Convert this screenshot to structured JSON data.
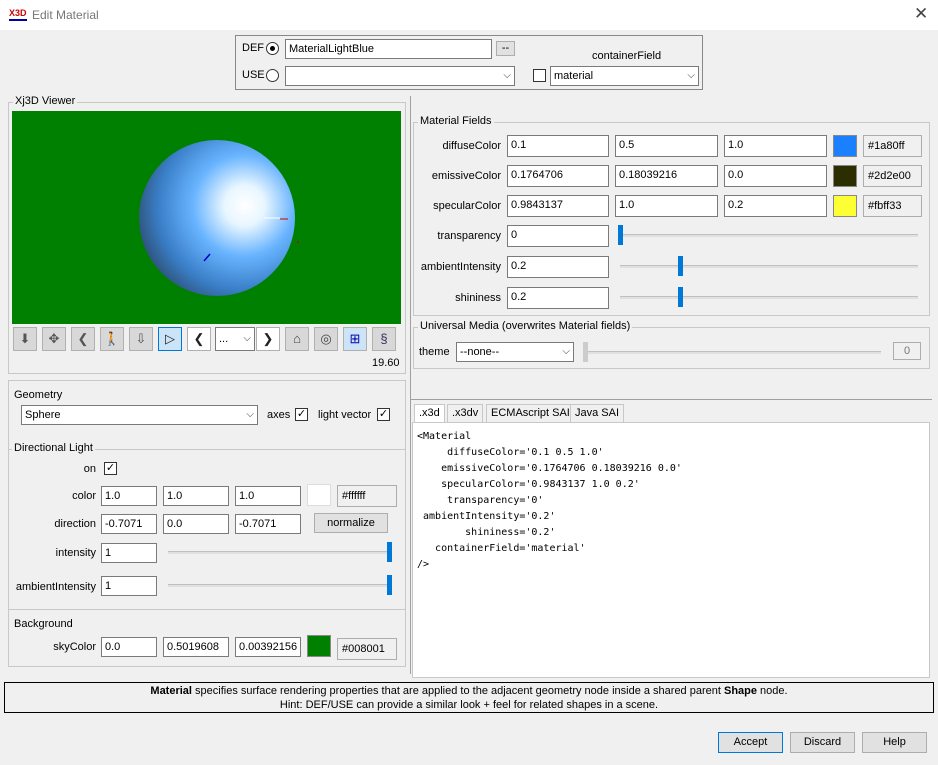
{
  "window": {
    "title": "Edit Material",
    "logo": "X3D"
  },
  "def_use": {
    "def_label": "DEF",
    "def_value": "MaterialLightBlue",
    "more_label": "--",
    "use_label": "USE",
    "use_value": "",
    "container_label": "containerField",
    "container_value": "material"
  },
  "viewer": {
    "title": "Xj3D Viewer",
    "zoom_value": "...",
    "frame_rate": "19.60",
    "background": "#008001"
  },
  "geometry": {
    "title": "Geometry",
    "shape": "Sphere",
    "axes_label": "axes",
    "light_vector_label": "light vector"
  },
  "light": {
    "title": "Directional Light",
    "on_label": "on",
    "color_label": "color",
    "color": [
      "1.0",
      "1.0",
      "1.0"
    ],
    "color_hex": "#ffffff",
    "direction_label": "direction",
    "direction": [
      "-0.7071",
      "0.0",
      "-0.7071"
    ],
    "normalize_label": "normalize",
    "intensity_label": "intensity",
    "intensity": "1",
    "intensity_level": 1.0,
    "ambient_label": "ambientIntensity",
    "ambient": "1",
    "ambient_level": 1.0
  },
  "background": {
    "title": "Background",
    "sky_label": "skyColor",
    "sky": [
      "0.0",
      "0.5019608",
      "0.00392156"
    ],
    "sky_hex": "#008001"
  },
  "material": {
    "title": "Material Fields",
    "diffuse_label": "diffuseColor",
    "diffuse": [
      "0.1",
      "0.5",
      "1.0"
    ],
    "diffuse_hex": "#1a80ff",
    "emissive_label": "emissiveColor",
    "emissive": [
      "0.1764706",
      "0.18039216",
      "0.0"
    ],
    "emissive_hex": "#2d2e00",
    "specular_label": "specularColor",
    "specular": [
      "0.9843137",
      "1.0",
      "0.2"
    ],
    "specular_hex": "#fbff33",
    "transparency_label": "transparency",
    "transparency": "0",
    "transparency_level": 0.0,
    "ambient_label": "ambientIntensity",
    "ambient": "0.2",
    "ambient_level": 0.2,
    "shininess_label": "shininess",
    "shininess": "0.2",
    "shininess_level": 0.2
  },
  "media": {
    "title": "Universal Media (overwrites Material fields)",
    "theme_label": "theme",
    "theme_value": "--none--",
    "theme_number": "0"
  },
  "tabs": [
    ".x3d",
    ".x3dv",
    "ECMAscript SAI",
    "Java SAI"
  ],
  "code": "<Material\n     diffuseColor='0.1 0.5 1.0'\n    emissiveColor='0.1764706 0.18039216 0.0'\n    specularColor='0.9843137 1.0 0.2'\n     transparency='0'\n ambientIntensity='0.2'\n        shininess='0.2'\n   containerField='material'\n/>",
  "hint": {
    "bold1": "Material",
    "text1": " specifies surface rendering properties that are applied to the adjacent geometry node inside a shared parent ",
    "bold2": "Shape",
    "text2": " node.",
    "line2": "Hint: DEF/USE can provide a similar look + feel for related shapes in a scene."
  },
  "buttons": {
    "accept": "Accept",
    "discard": "Discard",
    "help": "Help"
  },
  "colors": {
    "accent": "#0078d7"
  }
}
